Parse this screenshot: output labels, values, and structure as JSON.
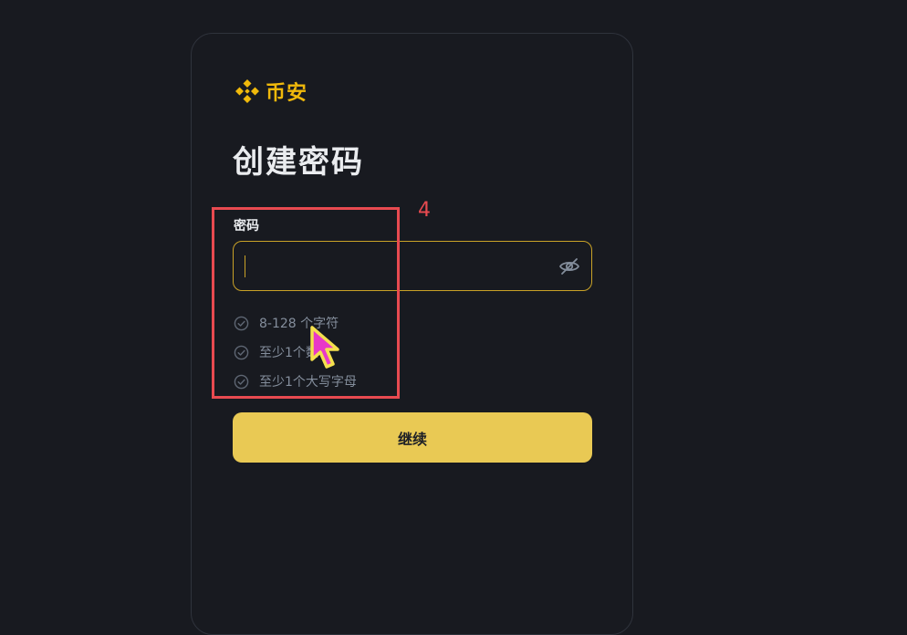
{
  "brand": {
    "name": "币安",
    "logo_icon": "binance-logo-icon",
    "color": "#f0b90b"
  },
  "page": {
    "title": "创建密码"
  },
  "password_field": {
    "label": "密码",
    "value": "",
    "placeholder": "",
    "toggle_icon": "eye-off-icon"
  },
  "requirements": [
    {
      "text": "8-128 个字符",
      "icon": "check-circle-icon",
      "met": false
    },
    {
      "text": "至少1个数字",
      "icon": "check-circle-icon",
      "met": false
    },
    {
      "text": "至少1个大写字母",
      "icon": "check-circle-icon",
      "met": false
    }
  ],
  "continue_button": {
    "label": "继续",
    "color": "#e9c954"
  },
  "annotation": {
    "number": "4",
    "color": "#e84a50"
  },
  "cursor": {
    "icon": "pointer-cursor-icon",
    "color": "#e838c8"
  }
}
